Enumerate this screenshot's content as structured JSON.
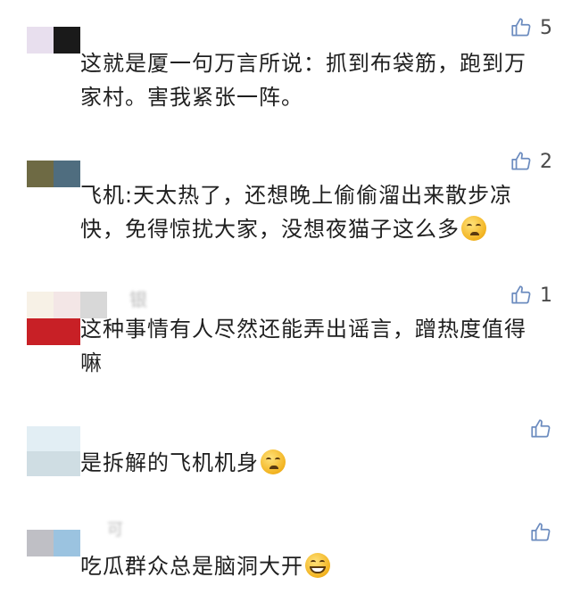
{
  "comments": [
    {
      "name": "",
      "avatar_colors": [
        "#e8dfee",
        "#1a1a1a"
      ],
      "likes": "5",
      "line1": "这就是厦一句万言所说：抓到布袋筋，跑到万",
      "line2": "家村。害我紧张一阵。"
    },
    {
      "name": "",
      "avatar_colors": [
        "#6e6a44",
        "#4f6d7f"
      ],
      "likes": "2",
      "line1": "飞机:天太热了，还想晚上偷偷溜出来散步凉",
      "line2": "快，免得惊扰大家，没想夜猫子这么多"
    },
    {
      "name": "银",
      "avatar_colors": [
        "#f7f1e6",
        "#c82026",
        "#d8d8d8"
      ],
      "likes": "1",
      "line1": "这种事情有人尽然还能弄出谣言，蹭热度值得",
      "line2": "嘛"
    },
    {
      "name": "",
      "avatar_colors": [
        "#e2eef4",
        "#cfdde3"
      ],
      "likes": "",
      "line1": "是拆解的飞机机身"
    },
    {
      "name": "可",
      "avatar_colors": [
        "#bfbfc5",
        "#9bc3e0"
      ],
      "likes": "",
      "line1": "吃瓜群众总是脑洞大开"
    }
  ],
  "icons": {
    "like": "thumbs-up-icon"
  },
  "colors": {
    "like_icon": "#6c8cbf"
  }
}
